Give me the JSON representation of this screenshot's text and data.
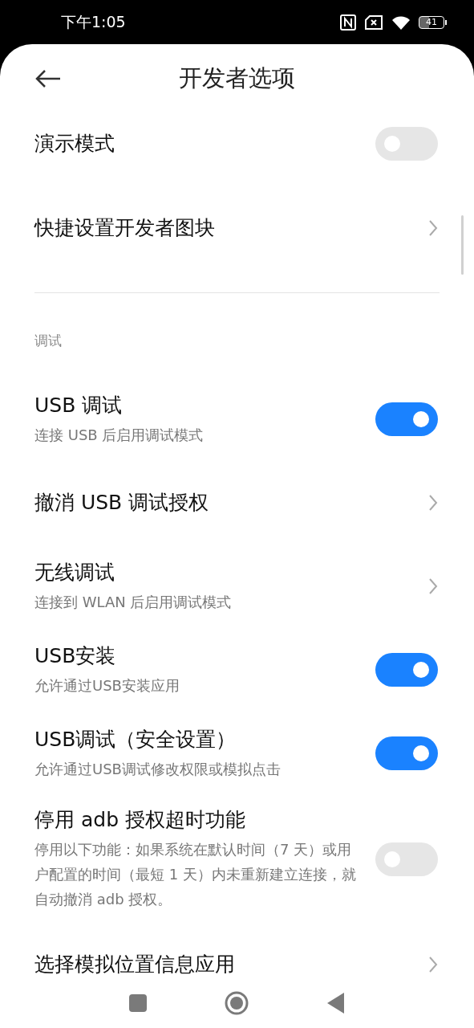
{
  "status_bar": {
    "time": "下午1:05",
    "battery": "41"
  },
  "header": {
    "title": "开发者选项"
  },
  "top_items": [
    {
      "kind": "switch",
      "title": "演示模式",
      "on": false
    },
    {
      "kind": "link",
      "title": "快捷设置开发者图块"
    }
  ],
  "section": {
    "label": "调试",
    "items": [
      {
        "kind": "switch",
        "title": "USB 调试",
        "subtitle": "连接 USB 后启用调试模式",
        "on": true
      },
      {
        "kind": "link",
        "title": "撤消 USB 调试授权"
      },
      {
        "kind": "link",
        "title": "无线调试",
        "subtitle": "连接到 WLAN 后启用调试模式"
      },
      {
        "kind": "switch",
        "title": "USB安装",
        "subtitle": "允许通过USB安装应用",
        "on": true
      },
      {
        "kind": "switch",
        "title": "USB调试（安全设置）",
        "subtitle": "允许通过USB调试修改权限或模拟点击",
        "on": true
      },
      {
        "kind": "switch",
        "title": "停用 adb 授权超时功能",
        "subtitle": "停用以下功能：如果系统在默认时间（7 天）或用户配置的时间（最短 1 天）内未重新建立连接，就自动撤消 adb 授权。",
        "on": false
      },
      {
        "kind": "link",
        "title": "选择模拟位置信息应用"
      }
    ]
  }
}
